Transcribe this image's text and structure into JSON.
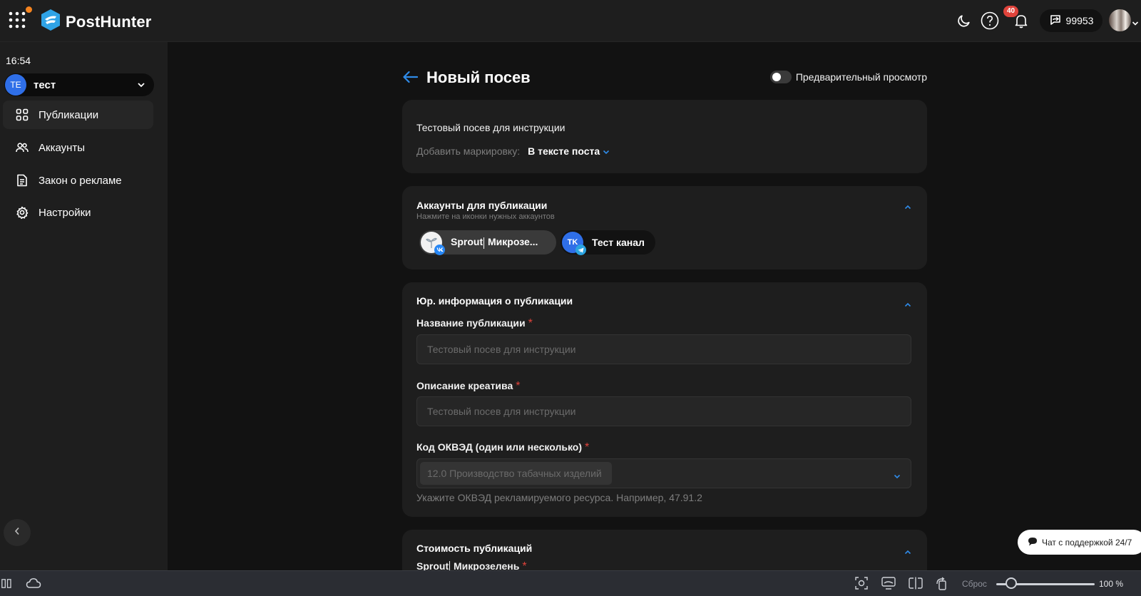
{
  "app": {
    "logo_text": "PostHunter",
    "notifications_count": "40",
    "balance": "99953"
  },
  "sidebar": {
    "time": "16:54",
    "project": {
      "initials": "TE",
      "name": "тест"
    },
    "items": [
      {
        "label": "Публикации",
        "icon": "grid-icon",
        "active": true
      },
      {
        "label": "Аккаунты",
        "icon": "users-icon",
        "active": false
      },
      {
        "label": "Закон о рекламе",
        "icon": "document-icon",
        "active": false
      },
      {
        "label": "Настройки",
        "icon": "gear-icon",
        "active": false
      }
    ]
  },
  "page": {
    "title": "Новый посев",
    "preview_label": "Предварительный просмотр",
    "preview_enabled": false
  },
  "post_card": {
    "text": "Тестовый посев для инструкции",
    "marking_label": "Добавить маркировку:",
    "marking_value": "В тексте поста"
  },
  "accounts_card": {
    "title": "Аккаунты для публикации",
    "subtitle": "Нажмите на иконки нужных аккаунтов",
    "accounts": [
      {
        "name_before_cursor": "Sprout",
        "name_after_cursor": " Микрозе...",
        "network": "vk",
        "selected": true
      },
      {
        "initials": "TK",
        "name": "Тест канал",
        "network": "telegram",
        "selected": false
      }
    ]
  },
  "legal_card": {
    "title": "Юр. информация о публикации",
    "fields": {
      "publication_name": {
        "label": "Название публикации",
        "placeholder": "Тестовый посев для инструкции"
      },
      "creative_description": {
        "label": "Описание креатива",
        "placeholder": "Тестовый посев для инструкции"
      },
      "okved": {
        "label": "Код ОКВЭД (один или несколько)",
        "selected_tag": "12.0 Производство табачных изделий",
        "hint": "Укажите ОКВЭД рекламируемого ресурса. Например, 47.91.2"
      }
    }
  },
  "cost_card": {
    "title": "Стоимость публикаций",
    "account_before_cursor": "Sprout",
    "account_after_cursor": " Микрозелень"
  },
  "support": {
    "label": "Чат с поддержкой 24/7"
  },
  "statusbar": {
    "reset_label": "Сброс",
    "zoom": "100 %",
    "zoom_percent": 100
  },
  "colors": {
    "accent": "#2f6fe8",
    "required": "#e0433b",
    "card_bg": "#1e1e1e",
    "page_bg": "#121212"
  }
}
